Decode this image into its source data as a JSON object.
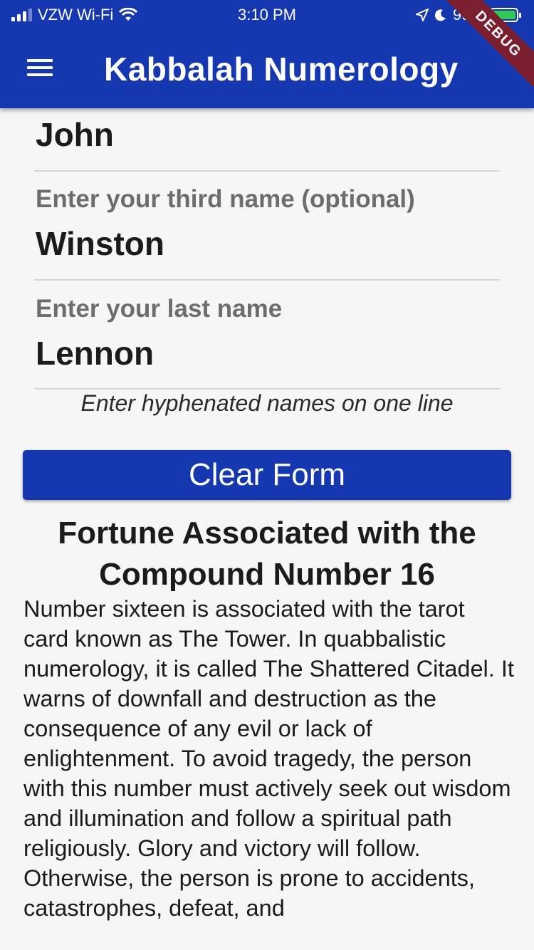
{
  "status_bar": {
    "carrier": "VZW Wi-Fi",
    "time": "3:10 PM",
    "battery": "99%"
  },
  "app_bar": {
    "title": "Kabbalah Numerology",
    "debug_banner": "DEBUG"
  },
  "form": {
    "second_name_value": "John",
    "third_name_label": "Enter your third name (optional)",
    "third_name_value": "Winston",
    "last_name_label": "Enter your last name",
    "last_name_value": "Lennon",
    "hint": "Enter hyphenated names on one line",
    "clear_button": "Clear Form"
  },
  "result": {
    "title": "Fortune Associated with the Compound Number 16",
    "body": "Number sixteen is associated with the tarot card known as The Tower. In quabbalistic numerology, it is called The Shattered Citadel. It warns of downfall and destruction as the consequence of any evil or lack of enlightenment. To avoid tragedy, the person with this number must actively seek out wisdom and illumination and follow a spiritual path religiously. Glory and victory will follow. Otherwise, the person is prone to accidents, catastrophes, defeat, and"
  },
  "colors": {
    "primary": "#1537b0",
    "debug_banner": "#7a1f2f",
    "background": "#f6f6f6"
  }
}
